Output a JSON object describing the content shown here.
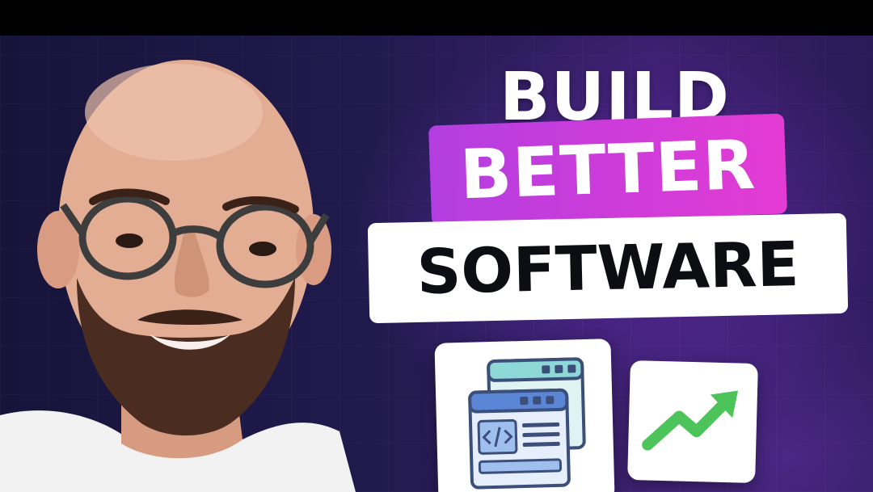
{
  "headline": {
    "line1": "BUILD",
    "line2": "BETTER",
    "line3": "SOFTWARE"
  },
  "icons": {
    "windows_card": "code-windows-icon",
    "growth_card": "trending-up-arrow-icon"
  },
  "colors": {
    "highlight_start": "#b33ee0",
    "highlight_end": "#e43bd3",
    "background": "#1f1a4c",
    "arrow_green": "#4cc45a",
    "window_blue": "#5b86d6",
    "window_teal": "#8fd8d8"
  }
}
